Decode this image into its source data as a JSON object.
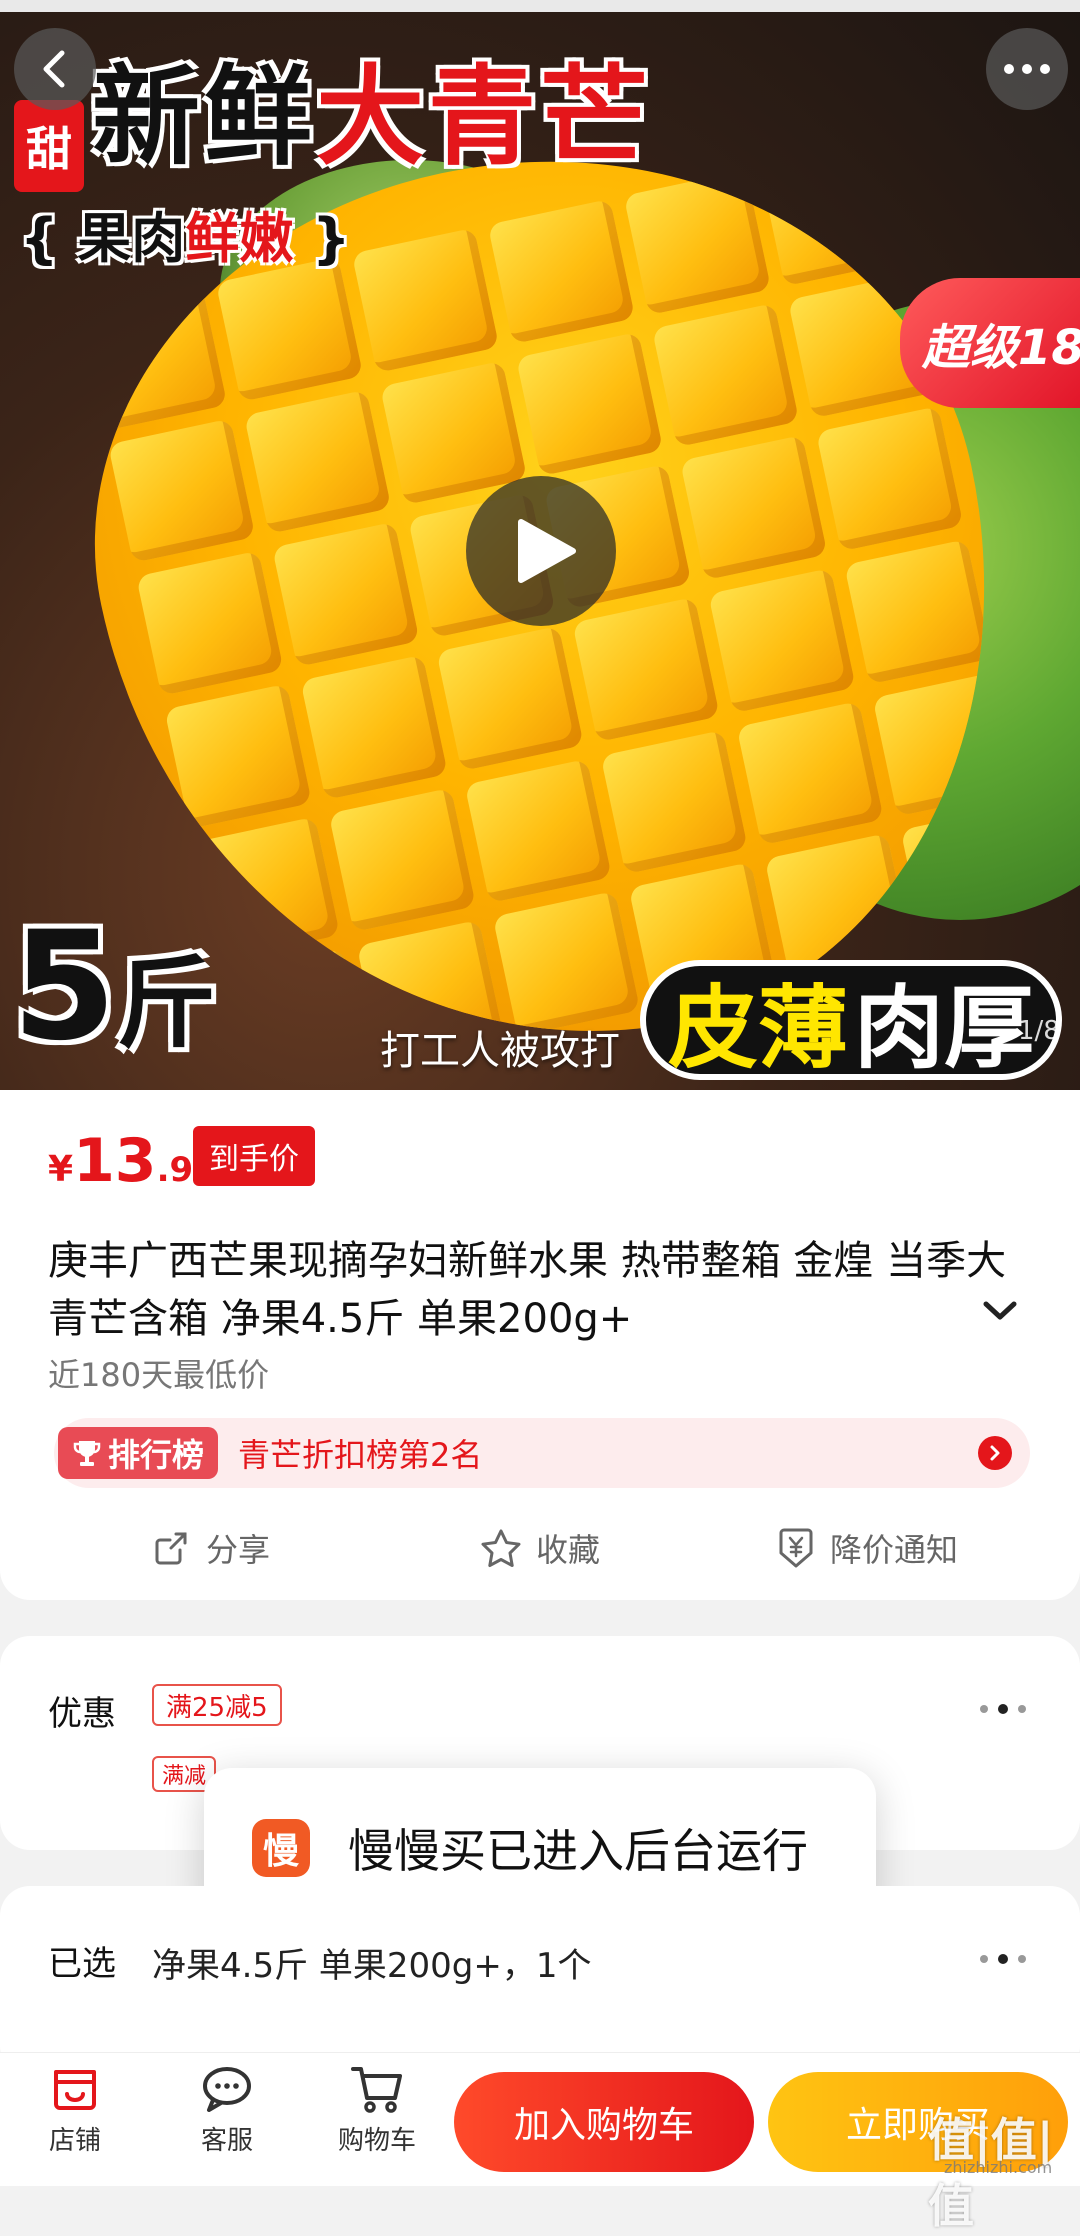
{
  "hero": {
    "title_black": "新鲜",
    "title_red": "大青芒",
    "sweet_badge": "甜",
    "subtitle_open": "{ 果肉",
    "subtitle_red": "鲜嫩",
    "subtitle_close": " }",
    "promo_ribbon": "超级18",
    "weight_number": "5",
    "weight_unit": "斤",
    "thin_skin_yellow": "皮薄",
    "thin_skin_white": "肉厚",
    "video_caption": "打工人被攻打",
    "image_counter": "1/8"
  },
  "price": {
    "symbol": "¥",
    "integer": "13",
    "decimal": ".90",
    "tag": "到手价"
  },
  "product": {
    "title": "庚丰广西芒果现摘孕妇新鲜水果 热带整箱 金煌 当季大青芒含箱 净果4.5斤 单果200g+",
    "lowest_note": "近180天最低价"
  },
  "ranking": {
    "badge": "排行榜",
    "text": "青芒折扣榜第2名"
  },
  "actions": {
    "share": "分享",
    "favorite": "收藏",
    "price_alert": "降价通知"
  },
  "promo": {
    "label": "优惠",
    "coupon": "满25减5",
    "tag2": "满减"
  },
  "toast": {
    "icon_char": "慢",
    "text": "慢慢买已进入后台运行"
  },
  "spec": {
    "label": "已选",
    "value": "净果4.5斤 单果200g+，1个"
  },
  "bottom_nav": {
    "shop": "店铺",
    "service": "客服",
    "cart": "购物车",
    "add_to_cart": "加入购物车",
    "buy_now": "立即购买"
  },
  "watermark": {
    "main": "值|值|值",
    "sub": "zhizhizhi.com"
  },
  "colors": {
    "brand_red": "#e4161b",
    "buy_yellow": "#ffb00f"
  }
}
